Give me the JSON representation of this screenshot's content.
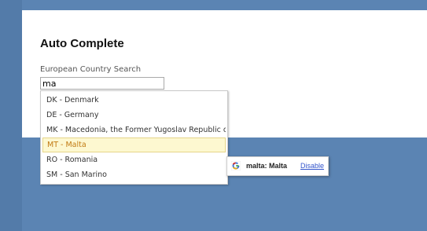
{
  "page": {
    "title": "Auto Complete",
    "field_label": "European Country Search"
  },
  "search": {
    "value": "ma"
  },
  "dropdown": {
    "options": [
      "DK - Denmark",
      "DE - Germany",
      "MK - Macedonia, the Former Yugoslav Republic of",
      "MT - Malta",
      "RO - Romania",
      "SM - San Marino"
    ],
    "active_index": 3
  },
  "tooltip": {
    "suggestion": "malta: Malta",
    "disable_label": "Disable",
    "icon": "google-g-icon"
  },
  "colors": {
    "background": "#5b84b3",
    "highlight_bg": "#fdf8d0",
    "highlight_text": "#c27a12",
    "link": "#3355cc"
  }
}
